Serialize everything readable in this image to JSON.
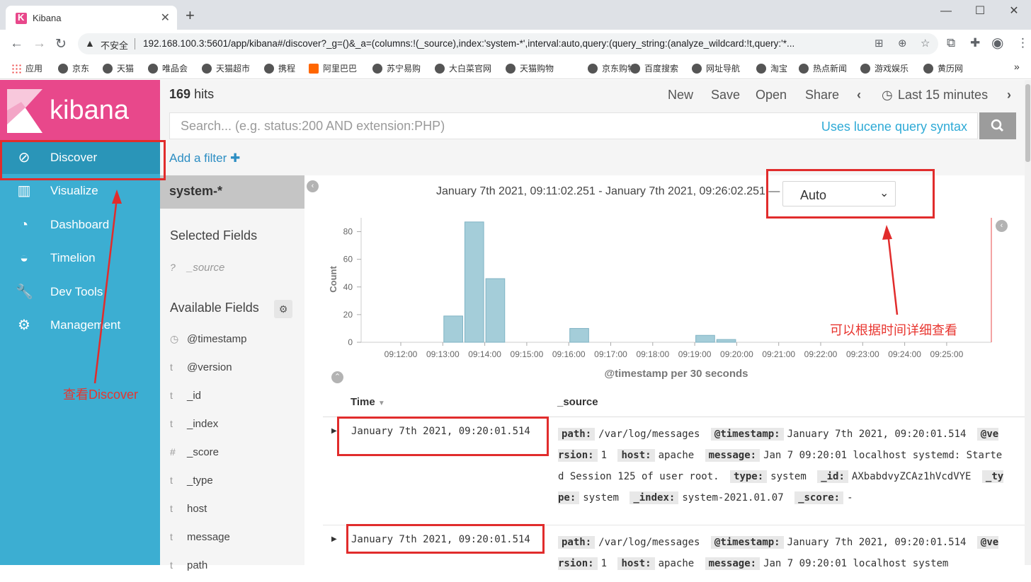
{
  "browser": {
    "tab_title": "Kibana",
    "insecure_label": "不安全",
    "url": "192.168.100.3:5601/app/kibana#/discover?_g=()&_a=(columns:!(_source),index:'system-*',interval:auto,query:(query_string:(analyze_wildcard:!t,query:'*...",
    "bookmarks": [
      "应用",
      "京东",
      "天猫",
      "唯品会",
      "天猫超市",
      "携程",
      "阿里巴巴",
      "苏宁易购",
      "大白菜官网",
      "天猫购物",
      "京东购物",
      "百度搜索",
      "网址导航",
      "淘宝",
      "热点新闻",
      "游戏娱乐",
      "黄历网"
    ]
  },
  "kibana": {
    "logo_text": "kibana",
    "nav": [
      {
        "label": "Discover",
        "icon": "compass-icon"
      },
      {
        "label": "Visualize",
        "icon": "bar-chart-icon"
      },
      {
        "label": "Dashboard",
        "icon": "dashboard-icon"
      },
      {
        "label": "Timelion",
        "icon": "timelion-icon"
      },
      {
        "label": "Dev Tools",
        "icon": "wrench-icon"
      },
      {
        "label": "Management",
        "icon": "gear-icon"
      }
    ]
  },
  "topbar": {
    "hits_count": "169",
    "hits_label": "hits",
    "menu": [
      "New",
      "Save",
      "Open",
      "Share"
    ],
    "time_label": "Last 15 minutes"
  },
  "query": {
    "placeholder": "Search... (e.g. status:200 AND extension:PHP)",
    "syntax_link": "Uses lucene query syntax",
    "add_filter": "Add a filter"
  },
  "sidebar": {
    "index_pattern": "system-*",
    "selected_heading": "Selected Fields",
    "selected_fields": [
      {
        "type": "?",
        "name": "_source"
      }
    ],
    "available_heading": "Available Fields",
    "available_fields": [
      {
        "type": "clock",
        "name": "@timestamp"
      },
      {
        "type": "t",
        "name": "@version"
      },
      {
        "type": "t",
        "name": "_id"
      },
      {
        "type": "t",
        "name": "_index"
      },
      {
        "type": "#",
        "name": "_score"
      },
      {
        "type": "t",
        "name": "_type"
      },
      {
        "type": "t",
        "name": "host"
      },
      {
        "type": "t",
        "name": "message"
      },
      {
        "type": "t",
        "name": "path"
      }
    ]
  },
  "main": {
    "time_range": "January 7th 2021, 09:11:02.251 - January 7th 2021, 09:26:02.251 —",
    "interval_value": "Auto"
  },
  "chart_data": {
    "type": "bar",
    "x": [
      "09:13:30",
      "09:14:00",
      "09:14:30",
      "09:16:30",
      "09:19:30",
      "09:20:00"
    ],
    "values": [
      19,
      87,
      46,
      10,
      5,
      2
    ],
    "xticks": [
      "09:12:00",
      "09:13:00",
      "09:14:00",
      "09:15:00",
      "09:16:00",
      "09:17:00",
      "09:18:00",
      "09:19:00",
      "09:20:00",
      "09:21:00",
      "09:22:00",
      "09:23:00",
      "09:24:00",
      "09:25:00"
    ],
    "yticks": [
      "0",
      "20",
      "40",
      "60",
      "80"
    ],
    "ylim": [
      0,
      90
    ],
    "xlabel": "@timestamp per 30 seconds",
    "ylabel": "Count",
    "bar_color": "#a4cdd9"
  },
  "table": {
    "col_time": "Time",
    "col_source": "_source",
    "rows": [
      {
        "time": "January 7th 2021, 09:20:01.514",
        "source": [
          [
            "path:",
            "/var/log/messages"
          ],
          [
            "@timestamp:",
            "January 7th 2021, 09:20:01.514"
          ],
          [
            "@version:",
            "1"
          ],
          [
            "host:",
            "apache"
          ],
          [
            "message:",
            "Jan 7 09:20:01 localhost systemd: Started Session 125 of user root."
          ],
          [
            "type:",
            "system"
          ],
          [
            "_id:",
            "AXbabdvyZCAz1hVcdVYE"
          ],
          [
            "_type:",
            "system"
          ],
          [
            "_index:",
            "system-2021.01.07"
          ],
          [
            "_score:",
            "-"
          ]
        ]
      },
      {
        "time": "January 7th 2021, 09:20:01.514",
        "source": [
          [
            "path:",
            "/var/log/messages"
          ],
          [
            "@timestamp:",
            "January 7th 2021, 09:20:01.514"
          ],
          [
            "@version:",
            "1"
          ],
          [
            "host:",
            "apache"
          ],
          [
            "message:",
            "Jan 7 09:20:01 localhost system"
          ]
        ]
      }
    ]
  },
  "annotations": {
    "discover_note": "查看Discover",
    "time_note": "可以根据时间详细查看"
  },
  "colors": {
    "kibana_pink": "#e8488b",
    "nav_blue": "#3caed2",
    "annotation_red": "#e12c2c",
    "link_blue": "#2eaad6"
  }
}
